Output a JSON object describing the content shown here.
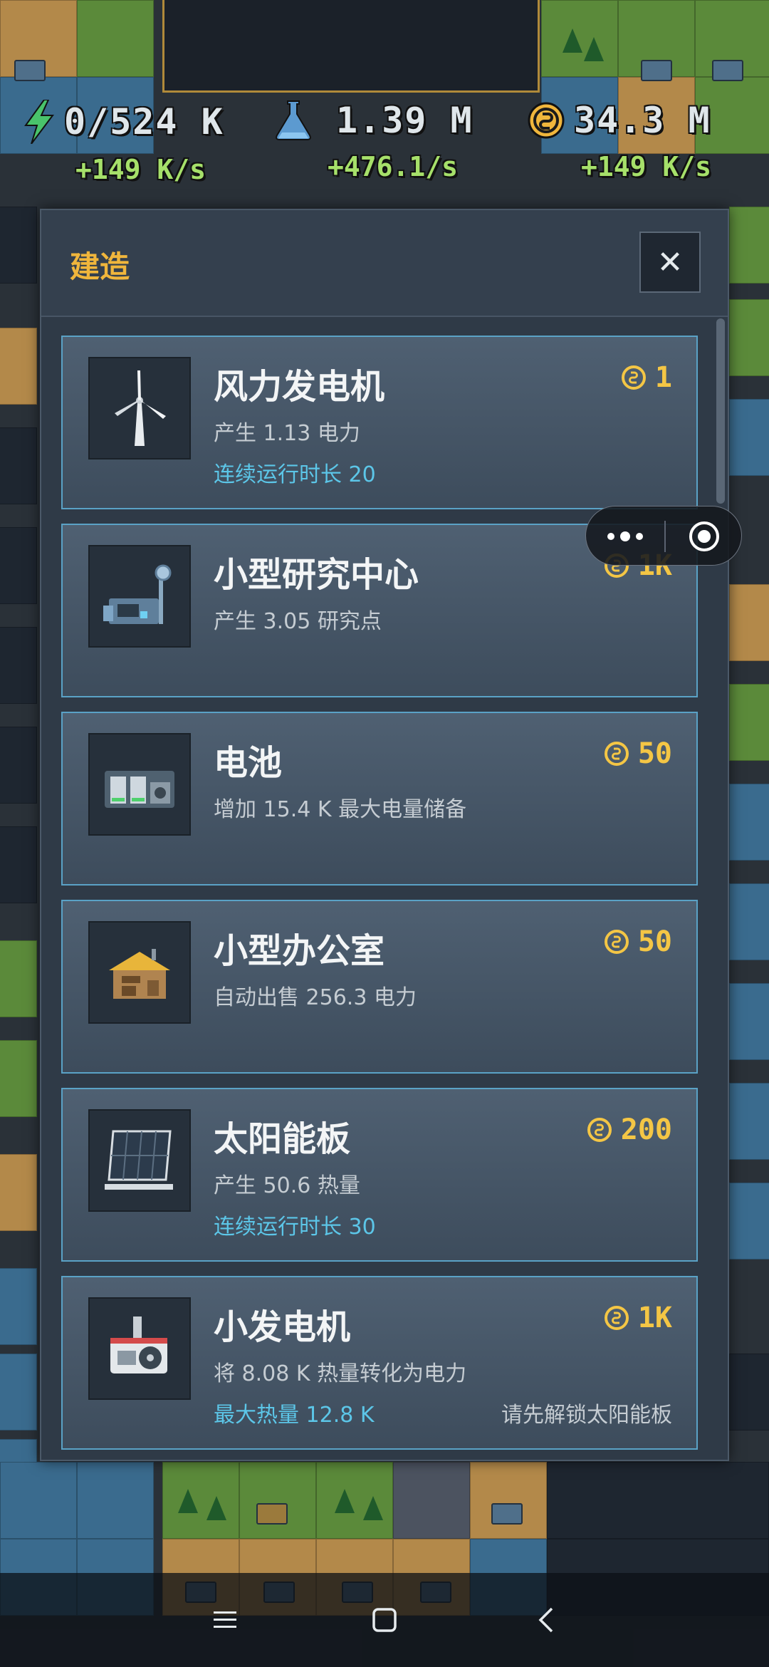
{
  "hud": {
    "energy": {
      "icon": "lightning-icon",
      "value": "0/524 K",
      "rate": "+149 K/s"
    },
    "research": {
      "icon": "flask-icon",
      "value": "1.39 M",
      "rate": "+476.1/s"
    },
    "money": {
      "icon": "coin-icon",
      "value": "34.3 M",
      "rate": "+149 K/s"
    }
  },
  "panel": {
    "title": "建造",
    "close_icon": "close-icon",
    "items": [
      {
        "name": "风力发电机",
        "price": "1",
        "desc": "产生 1.13 电力",
        "extra": "连续运行时长 20",
        "lock": "",
        "icon": "wind-turbine-icon"
      },
      {
        "name": "小型研究中心",
        "price": "1K",
        "desc": "产生 3.05 研究点",
        "extra": "",
        "lock": "",
        "icon": "research-center-icon"
      },
      {
        "name": "电池",
        "price": "50",
        "desc": "增加 15.4 K 最大电量储备",
        "extra": "",
        "lock": "",
        "icon": "battery-icon"
      },
      {
        "name": "小型办公室",
        "price": "50",
        "desc": "自动出售 256.3 电力",
        "extra": "",
        "lock": "",
        "icon": "office-icon"
      },
      {
        "name": "太阳能板",
        "price": "200",
        "desc": "产生 50.6 热量",
        "extra": "连续运行时长 30",
        "lock": "",
        "icon": "solar-panel-icon"
      },
      {
        "name": "小发电机",
        "price": "1K",
        "desc": "将 8.08 K 热量转化为电力",
        "extra": "最大热量 12.8 K",
        "lock": "请先解锁太阳能板",
        "icon": "generator-icon"
      }
    ]
  },
  "capsule": {
    "more_icon": "more-dots-icon",
    "close_icon": "target-close-icon"
  },
  "navbar": {
    "menu_icon": "menu-icon",
    "home_icon": "home-icon",
    "back_icon": "back-icon"
  },
  "colors": {
    "accent_gold": "#f0b63c",
    "price": "#f4c645",
    "info_blue": "#5cc6e8",
    "rate_green": "#a6e06a",
    "card_border": "#5aa2c6"
  }
}
